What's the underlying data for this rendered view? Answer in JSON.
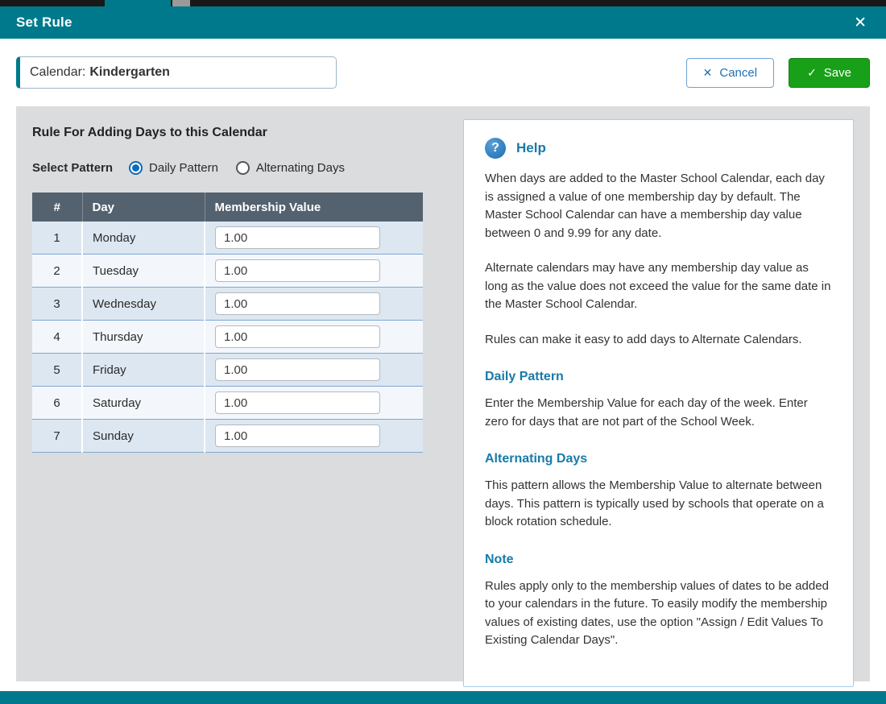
{
  "header": {
    "title": "Set Rule"
  },
  "icons": {
    "close": "✕",
    "cancel_x": "✕",
    "save_check": "✓",
    "help_q": "?"
  },
  "toolbar": {
    "calendar_label": "Calendar:",
    "calendar_value": "Kindergarten",
    "cancel_label": "Cancel",
    "save_label": "Save"
  },
  "rule": {
    "heading": "Rule For Adding Days to this Calendar",
    "pattern_label": "Select Pattern",
    "patterns": [
      {
        "label": "Daily Pattern",
        "selected": true
      },
      {
        "label": "Alternating Days",
        "selected": false
      }
    ]
  },
  "table": {
    "headers": [
      "#",
      "Day",
      "Membership Value"
    ],
    "rows": [
      {
        "num": "1",
        "day": "Monday",
        "value": "1.00"
      },
      {
        "num": "2",
        "day": "Tuesday",
        "value": "1.00"
      },
      {
        "num": "3",
        "day": "Wednesday",
        "value": "1.00"
      },
      {
        "num": "4",
        "day": "Thursday",
        "value": "1.00"
      },
      {
        "num": "5",
        "day": "Friday",
        "value": "1.00"
      },
      {
        "num": "6",
        "day": "Saturday",
        "value": "1.00"
      },
      {
        "num": "7",
        "day": "Sunday",
        "value": "1.00"
      }
    ]
  },
  "help": {
    "title": "Help",
    "intro": [
      "When days are added to the Master School Calendar, each day is assigned a value of one membership day by default. The Master School Calendar can have a membership day value between 0 and 9.99 for any date.",
      "Alternate calendars may have any membership day value as long as the value does not exceed the value for the same date in the Master School Calendar.",
      "Rules can make it easy to add days to Alternate Calendars."
    ],
    "sections": [
      {
        "heading": "Daily Pattern",
        "body": "Enter the Membership Value for each day of the week.  Enter zero for days that are not part of the School Week."
      },
      {
        "heading": "Alternating Days",
        "body": "This pattern allows the Membership Value to alternate between days. This pattern is typically used by schools that operate on a block rotation schedule."
      },
      {
        "heading": "Note",
        "body": "Rules apply only to the membership values of dates to be added to your calendars in the future. To easily modify the membership values of existing dates, use the option \"Assign / Edit Values To Existing Calendar Days\"."
      }
    ]
  },
  "colors": {
    "teal_header": "#00798c",
    "save_green": "#18a018",
    "cancel_blue": "#1f6fb5",
    "help_heading_teal": "#177ba8",
    "table_header_slate": "#54616e",
    "row_alt_blue": "#dde7f1"
  }
}
